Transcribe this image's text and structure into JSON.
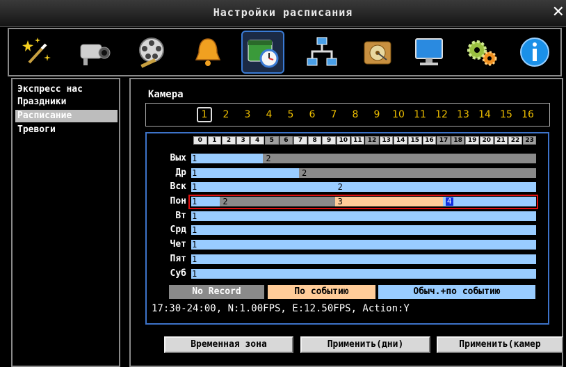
{
  "window": {
    "title": "Настройки расписания"
  },
  "toolbar": {
    "icons": [
      "wizard-icon",
      "camera-icon",
      "film-reel-icon",
      "alarm-bell-icon",
      "schedule-icon",
      "network-icon",
      "hdd-icon",
      "monitor-icon",
      "settings-gears-icon",
      "info-icon"
    ],
    "selected_index": 4
  },
  "menu": {
    "items": [
      "Экспресс нас",
      "Праздники",
      "Расписание",
      "Тревоги"
    ],
    "active_index": 2
  },
  "camera": {
    "label": "Камера",
    "numbers": [
      "1",
      "2",
      "3",
      "4",
      "5",
      "6",
      "7",
      "8",
      "9",
      "10",
      "11",
      "12",
      "13",
      "14",
      "15",
      "16"
    ],
    "selected": "1"
  },
  "schedule": {
    "hours": [
      "0",
      "1",
      "2",
      "3",
      "4",
      "5",
      "6",
      "7",
      "8",
      "9",
      "10",
      "11",
      "12",
      "13",
      "14",
      "15",
      "16",
      "17",
      "18",
      "19",
      "20",
      "21",
      "22",
      "23"
    ],
    "days": [
      {
        "label": "Вых",
        "segments": [
          {
            "from": 0,
            "to": 5,
            "mode": "1"
          },
          {
            "from": 5,
            "to": 24,
            "mode": "2"
          }
        ]
      },
      {
        "label": "Др",
        "segments": [
          {
            "from": 0,
            "to": 7.5,
            "mode": "1"
          },
          {
            "from": 7.5,
            "to": 24,
            "mode": "2"
          }
        ]
      },
      {
        "label": "Вск",
        "segments": [
          {
            "from": 0,
            "to": 24,
            "mode": "1"
          }
        ]
      },
      {
        "label": "Пон",
        "segments": [
          {
            "from": 0,
            "to": 2,
            "mode": "1"
          },
          {
            "from": 2,
            "to": 10,
            "mode": "2"
          },
          {
            "from": 10,
            "to": 17.5,
            "mode": "3"
          },
          {
            "from": 17.5,
            "to": 24,
            "mode": "1"
          }
        ]
      },
      {
        "label": "Вт",
        "segments": [
          {
            "from": 0,
            "to": 24,
            "mode": "1"
          }
        ]
      },
      {
        "label": "Срд",
        "segments": [
          {
            "from": 0,
            "to": 24,
            "mode": "1"
          }
        ]
      },
      {
        "label": "Чет",
        "segments": [
          {
            "from": 0,
            "to": 24,
            "mode": "1"
          }
        ]
      },
      {
        "label": "Пят",
        "segments": [
          {
            "from": 0,
            "to": 24,
            "mode": "1"
          }
        ]
      },
      {
        "label": "Суб",
        "segments": [
          {
            "from": 0,
            "to": 24,
            "mode": "1"
          }
        ]
      }
    ],
    "segment_labels": [
      {
        "day": 0,
        "at": 0,
        "text": "1"
      },
      {
        "day": 0,
        "at": 5,
        "text": "2"
      },
      {
        "day": 1,
        "at": 0,
        "text": "1"
      },
      {
        "day": 1,
        "at": 7.5,
        "text": "2"
      },
      {
        "day": 2,
        "at": 0,
        "text": "1"
      },
      {
        "day": 2,
        "at": 10,
        "text": "2"
      },
      {
        "day": 3,
        "at": 0,
        "text": "1"
      },
      {
        "day": 3,
        "at": 2,
        "text": "2"
      },
      {
        "day": 3,
        "at": 10,
        "text": "3"
      },
      {
        "day": 3,
        "at": 17.5,
        "text": "4"
      },
      {
        "day": 4,
        "at": 0,
        "text": "1"
      },
      {
        "day": 5,
        "at": 0,
        "text": "1"
      },
      {
        "day": 6,
        "at": 0,
        "text": "1"
      },
      {
        "day": 7,
        "at": 0,
        "text": "1"
      },
      {
        "day": 8,
        "at": 0,
        "text": "1"
      }
    ],
    "selected_day": 3,
    "cursor_at": 17.5
  },
  "legend": [
    {
      "label": "No Record",
      "color": "#8a8a8a",
      "text_color": "#ffffff",
      "mode": "2"
    },
    {
      "label": "По событию",
      "color": "#ffcc99",
      "text_color": "#000000",
      "mode": "3"
    },
    {
      "label": "Обыч.+по событию",
      "color": "#99ccff",
      "text_color": "#000000",
      "mode": "1"
    }
  ],
  "info": "17:30-24:00, N:1.00FPS, E:12.50FPS, Action:Y",
  "buttons": {
    "timezone": "Временная зона",
    "apply_days": "Применить(дни)",
    "apply_cameras": "Применить(камер"
  },
  "colors": {
    "accent": "#3d73c9",
    "selected_outline": "#e01010",
    "camera_number": "#f0c000"
  }
}
